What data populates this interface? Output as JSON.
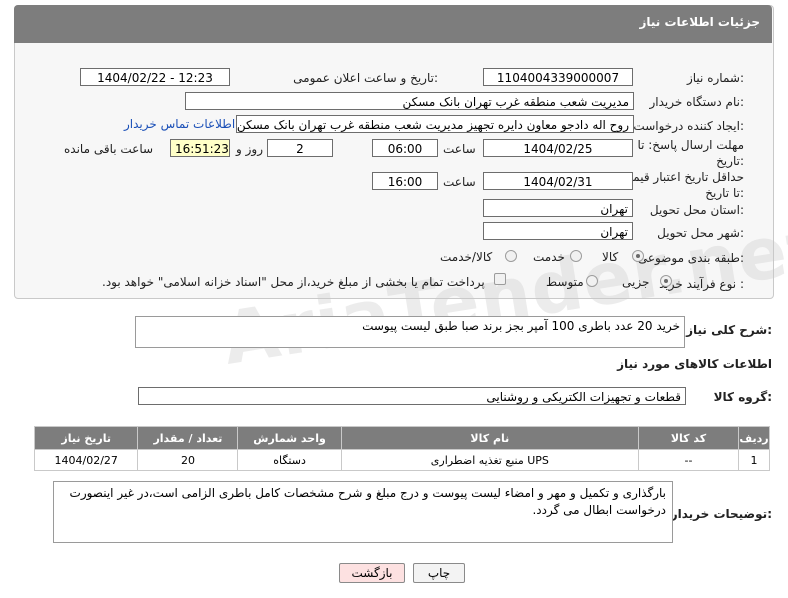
{
  "header": {
    "title": "جزئیات اطلاعات نیاز"
  },
  "fields": {
    "need_number_label": "شماره نیاز:",
    "need_number": "1104004339000007",
    "announce_label": "تاریخ و ساعت اعلان عمومی:",
    "announce_value": "1404/02/22 - 12:23",
    "buyer_org_label": "نام دستگاه خریدار:",
    "buyer_org": "مدیریت شعب منطقه غرب تهران بانک مسکن",
    "creator_label": "ایجاد کننده درخواست:",
    "creator": "روح اله دادجو معاون دایره تجهیز  مدیریت شعب منطقه غرب تهران بانک مسکن",
    "contact_link": "اطلاعات تماس خریدار",
    "deadline_label": "مهلت ارسال پاسخ: تا تاریخ:",
    "deadline_date": "1404/02/25",
    "time_label": "ساعت",
    "deadline_time": "06:00",
    "days_value": "2",
    "days_label": "روز و",
    "remaining_time": "16:51:23",
    "remaining_label": "ساعت باقی مانده",
    "price_valid_label": "حداقل تاریخ اعتبار قیمت: تا تاریخ:",
    "price_valid_date": "1404/02/31",
    "price_valid_time": "16:00",
    "province_label": "استان محل تحویل:",
    "province": "تهران",
    "city_label": "شهر محل تحویل:",
    "city": "تهران",
    "category_label": "طبقه بندی موضوعی:",
    "category_options": [
      "کالا",
      "خدمت",
      "کالا/خدمت"
    ],
    "process_label": "نوع فرآیند خرید :",
    "process_options": [
      "جزیی",
      "متوسط"
    ],
    "payment_note": "پرداخت تمام یا بخشی از مبلغ خرید،از محل \"اسناد خزانه اسلامی\" خواهد بود."
  },
  "summary": {
    "label": "شرح کلی نیاز:",
    "text": "خرید 20 عدد باطری 100 آمپر بجز برند صبا طبق لیست پیوست"
  },
  "goods": {
    "section_title": "اطلاعات کالاهای مورد نیاز",
    "group_label": "گروه کالا:",
    "group_value": "قطعات و تجهیزات الکتریکی و روشنایی",
    "columns": [
      "ردیف",
      "کد کالا",
      "نام کالا",
      "واحد شمارش",
      "تعداد / مقدار",
      "تاریخ نیاز"
    ],
    "rows": [
      [
        "1",
        "--",
        "منبع تغذیه اضطراری UPS",
        "دستگاه",
        "20",
        "1404/02/27"
      ]
    ]
  },
  "notes": {
    "label": "توضیحات خریدار:",
    "text": "بارگذاری و تکمیل و مهر و امضاء لیست پیوست و درج مبلغ و شرح مشخصات کامل باطری الزامی است،در غیر اینصورت درخواست ابطال می گردد."
  },
  "buttons": {
    "print": "چاپ",
    "back": "بازگشت"
  },
  "watermark": "AriaTender.net"
}
